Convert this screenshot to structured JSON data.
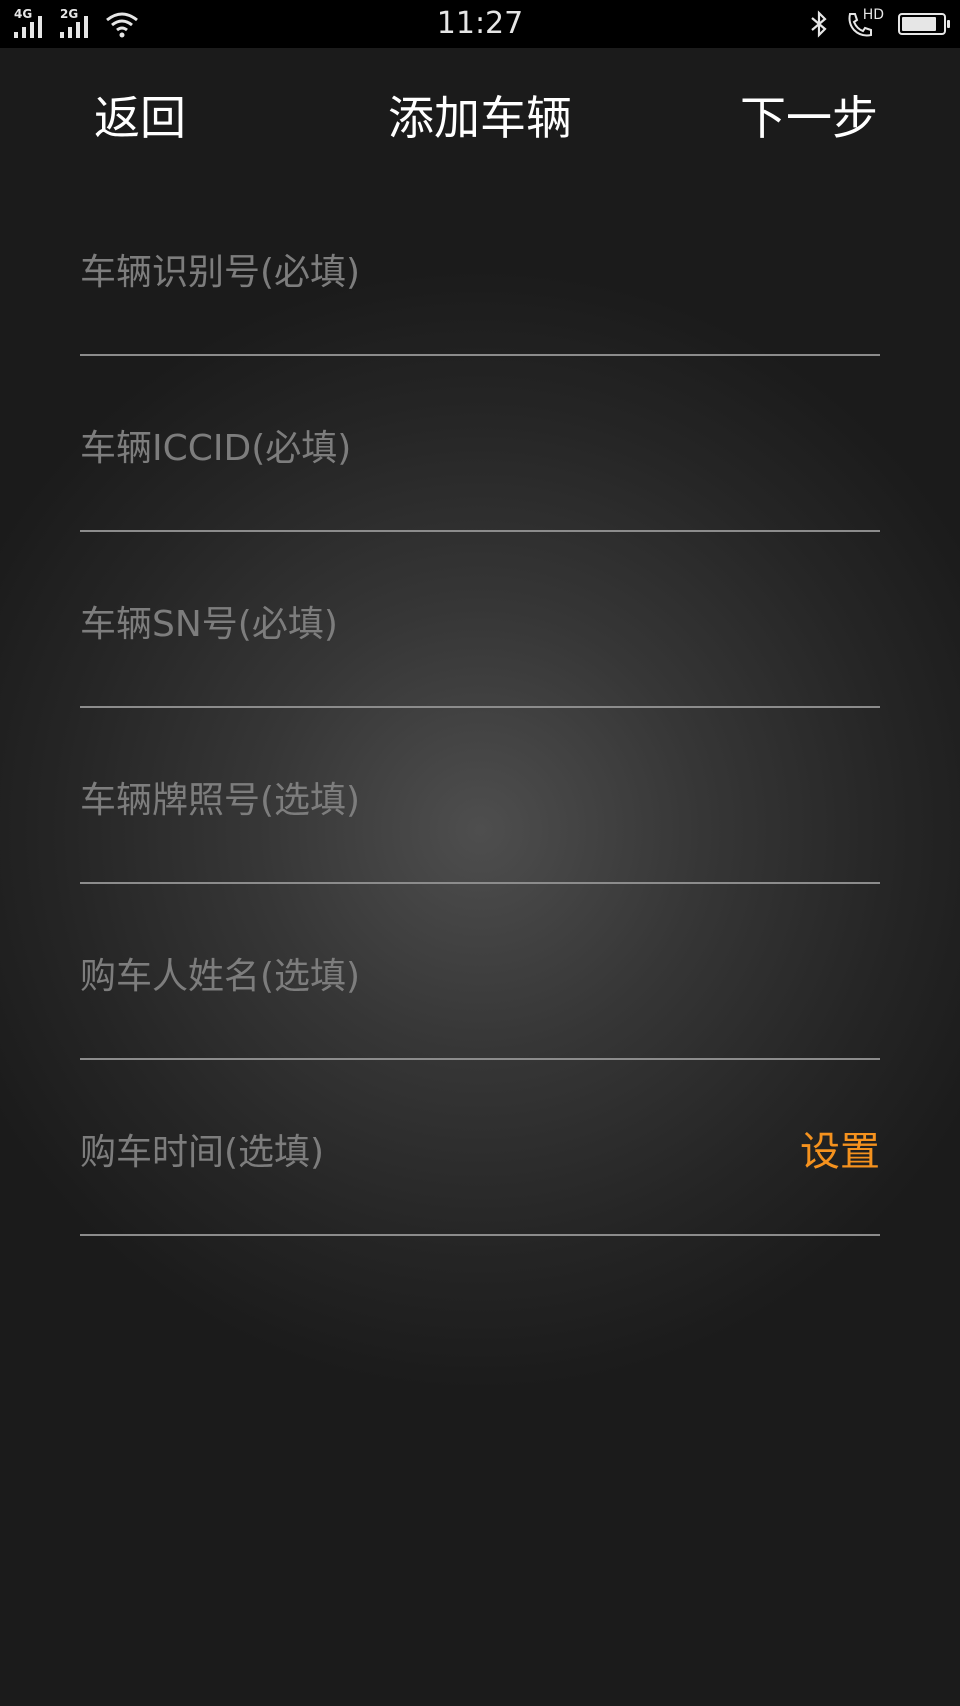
{
  "status_bar": {
    "network_1": "4G",
    "network_2": "2G",
    "time": "11:27",
    "hd_label": "HD",
    "battery_level_fraction": 0.85,
    "icons": [
      "signal-icon",
      "signal-icon",
      "wifi-icon",
      "bluetooth-icon",
      "hd-call-icon",
      "battery-icon"
    ]
  },
  "nav": {
    "back_label": "返回",
    "title": "添加车辆",
    "next_label": "下一步"
  },
  "form": {
    "vin_placeholder": "车辆识别号(必填)",
    "iccid_placeholder": "车辆ICCID(必填)",
    "sn_placeholder": "车辆SN号(必填)",
    "plate_placeholder": "车辆牌照号(选填)",
    "buyer_placeholder": "购车人姓名(选填)",
    "purchase_time_placeholder": "购车时间(选填)",
    "set_label": "设置"
  },
  "colors": {
    "accent": "#f5921e",
    "status_bar_bg": "#000000",
    "placeholder": "#7d7d7d",
    "divider": "#8c8c8c"
  }
}
